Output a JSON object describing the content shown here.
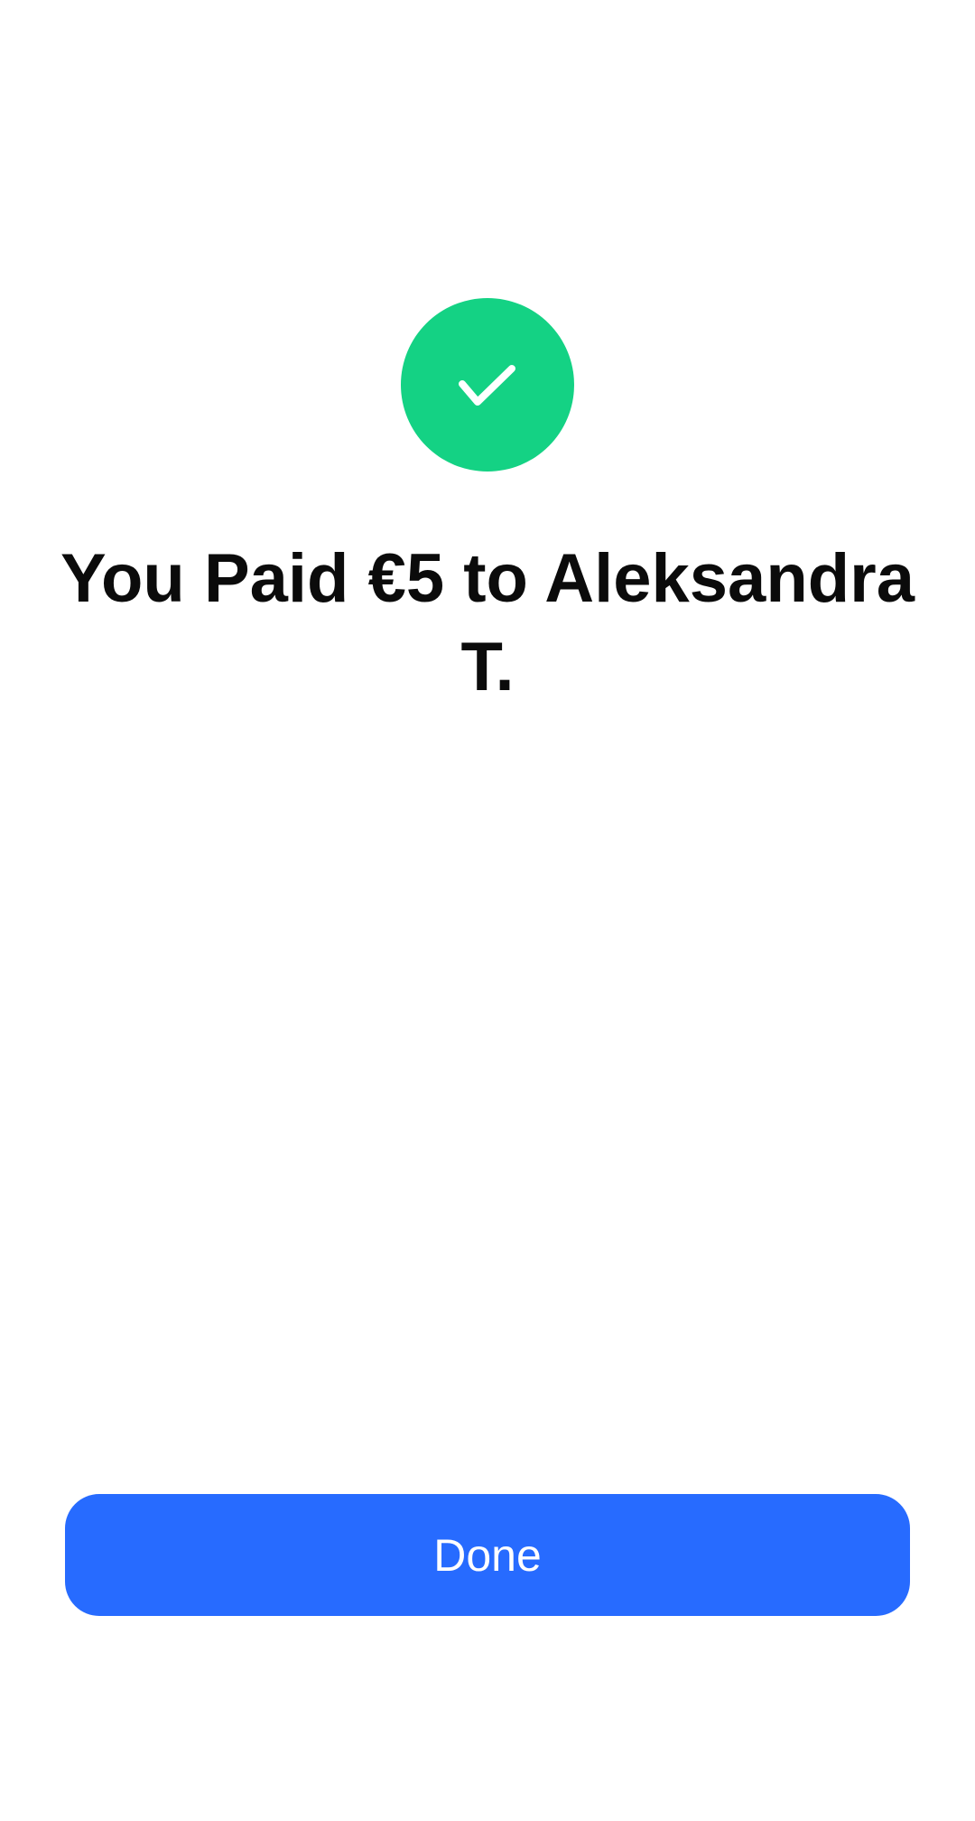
{
  "payment_confirmation": {
    "icon": "checkmark-icon",
    "title": "You Paid €5 to Aleksandra T.",
    "done_label": "Done"
  },
  "colors": {
    "success": "#14d284",
    "primary_button": "#276bff",
    "button_text": "#ffffff",
    "title_text": "#0b0b0b",
    "background": "#ffffff"
  }
}
